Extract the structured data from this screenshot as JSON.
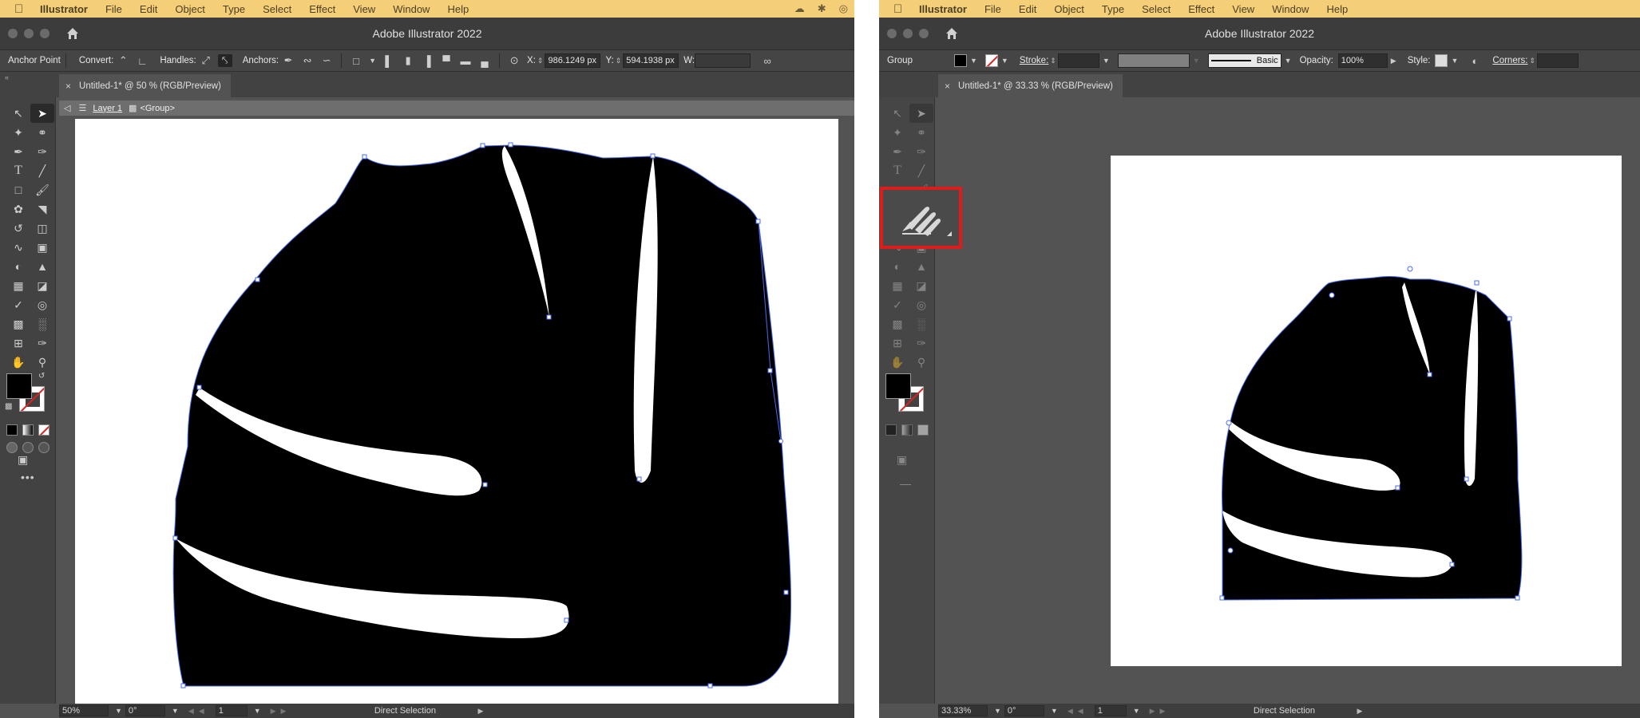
{
  "menubar": {
    "app_name": "Illustrator",
    "items": [
      "File",
      "Edit",
      "Object",
      "Type",
      "Select",
      "Effect",
      "View",
      "Window",
      "Help"
    ]
  },
  "left": {
    "window_title": "Adobe Illustrator 2022",
    "control": {
      "selection_label": "Anchor Point",
      "convert_label": "Convert:",
      "handles_label": "Handles:",
      "anchors_label": "Anchors:",
      "x_label": "X:",
      "x_value": "986.1249 px",
      "y_label": "Y:",
      "y_value": "594.1938 px",
      "w_label": "W:"
    },
    "doc_tab": "Untitled-1* @ 50 % (RGB/Preview)",
    "path": {
      "layer": "Layer 1",
      "group": "<Group>"
    },
    "status": {
      "zoom": "50%",
      "rotation": "0°",
      "artboard": "1",
      "tool": "Direct Selection"
    }
  },
  "right": {
    "window_title": "Adobe Illustrator 2022",
    "control": {
      "selection_label": "Group",
      "stroke_label": "Stroke:",
      "brush_label": "Basic",
      "opacity_label": "Opacity:",
      "opacity_value": "100%",
      "style_label": "Style:",
      "corners_label": "Corners:"
    },
    "doc_tab": "Untitled-1* @ 33.33 % (RGB/Preview)",
    "status": {
      "zoom": "33.33%",
      "rotation": "0°",
      "artboard": "1",
      "tool": "Direct Selection"
    }
  },
  "colors": {
    "menubar": "#f5cf77",
    "selection_blue": "#4a6cf0",
    "highlight": "#e01b1b",
    "fill": "#000000"
  },
  "icons": {
    "tools": [
      "selection-tool-icon",
      "direct-selection-tool-icon",
      "magic-wand-icon",
      "lasso-icon",
      "pen-tool-icon",
      "curvature-tool-icon",
      "type-tool-icon",
      "line-tool-icon",
      "rectangle-tool-icon",
      "paintbrush-icon",
      "shaper-tool-icon",
      "eraser-icon",
      "rotate-tool-icon",
      "scale-tool-icon",
      "warp-tool-icon",
      "free-transform-icon",
      "shape-builder-icon",
      "perspective-grid-icon",
      "mesh-tool-icon",
      "gradient-tool-icon",
      "eyedropper-icon",
      "blend-tool-icon",
      "symbol-sprayer-icon",
      "graph-tool-icon",
      "artboard-tool-icon",
      "slice-tool-icon",
      "hand-tool-icon",
      "zoom-tool-icon"
    ],
    "highlighted_tool": "shaper-tool-icon"
  }
}
